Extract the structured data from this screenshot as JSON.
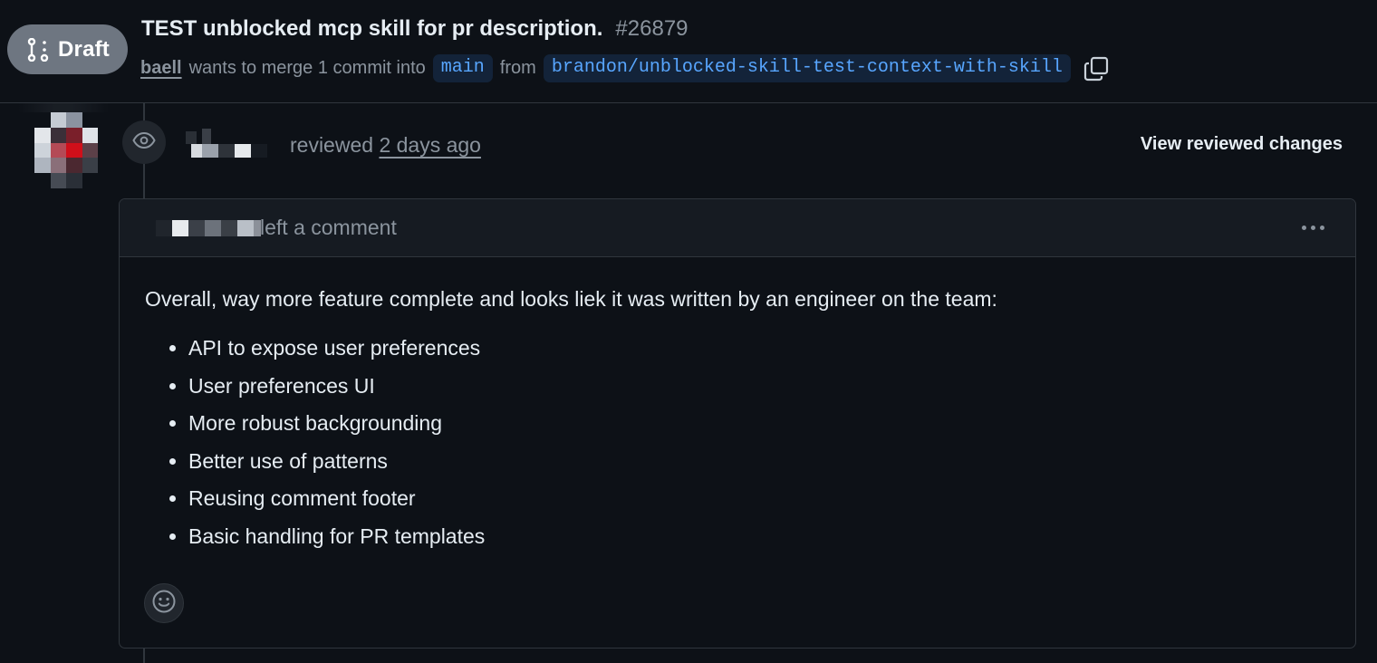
{
  "pr": {
    "status_label": "Draft",
    "title": "TEST unblocked mcp skill for pr description.",
    "number": "#26879",
    "author": "baell",
    "merge_text": "wants to merge 1 commit into",
    "base_branch": "main",
    "from_text": "from",
    "head_branch": "brandon/unblocked-skill-test-context-with-skill",
    "copy_icon": "copy-icon",
    "draft_icon": "git-pull-request-draft-icon"
  },
  "review": {
    "action_text": "reviewed",
    "time": "2 days ago",
    "view_changes_label": "View reviewed changes",
    "event_icon": "eye-icon"
  },
  "comment": {
    "header_text": "left a comment",
    "intro": "Overall, way more feature complete and looks liek it was written by an engineer on the team:",
    "items": [
      "API to expose user preferences",
      "User preferences UI",
      "More robust backgrounding",
      "Better use of patterns",
      "Reusing comment footer",
      "Basic handling for PR templates"
    ],
    "menu_icon": "kebab-horizontal-icon",
    "reaction_icon": "smiley-icon"
  },
  "colors": {
    "background": "#0d1117",
    "header_bg": "#161b22",
    "border": "#30363d",
    "muted_text": "#8b949e",
    "primary_text": "#e6edf3",
    "link_blue": "#58a6ff",
    "draft_badge": "#6e7681"
  }
}
